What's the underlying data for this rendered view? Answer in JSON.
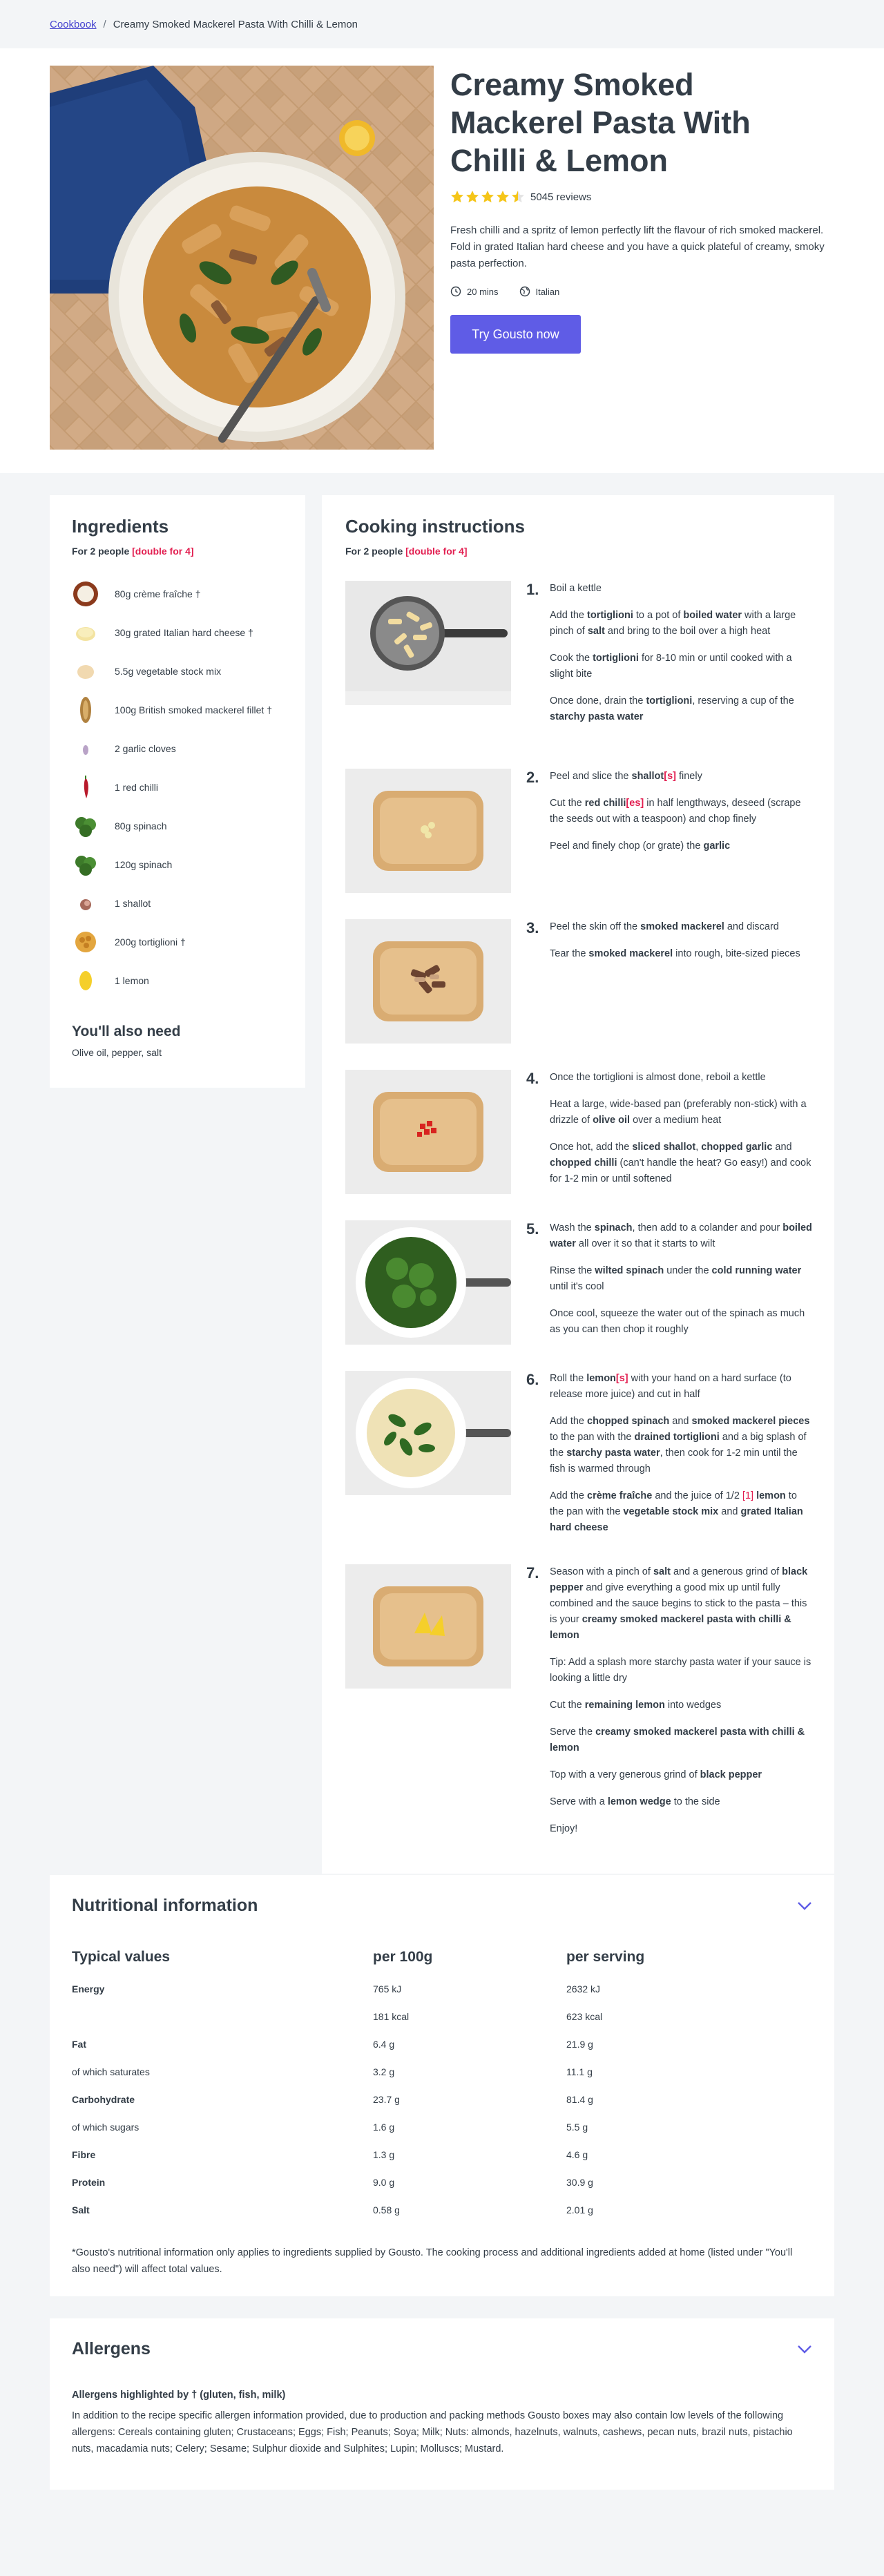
{
  "breadcrumb": {
    "root": "Cookbook",
    "separator": "/",
    "current": "Creamy Smoked Mackerel Pasta With Chilli & Lemon"
  },
  "hero": {
    "title": "Creamy Smoked Mackerel Pasta With Chilli & Lemon",
    "rating_stars": 4.5,
    "reviews": "5045 reviews",
    "description": "Fresh chilli and a spritz of lemon perfectly lift the flavour of rich smoked mackerel. Fold in grated Italian hard cheese and you have a quick plateful of creamy, smoky pasta perfection.",
    "time": "20 mins",
    "cuisine": "Italian",
    "cta": "Try Gousto now",
    "colors": {
      "accent": "#5f5ce6",
      "star": "#f5c518",
      "highlight": "#e21e50"
    }
  },
  "ingredients": {
    "heading": "Ingredients",
    "servings_prefix": "For 2 people",
    "servings_double": "[double for 4]",
    "items": [
      {
        "text": "80g crème fraîche †",
        "icon": "creme-fraiche-icon"
      },
      {
        "text": "30g grated Italian hard cheese †",
        "icon": "cheese-icon"
      },
      {
        "text": "5.5g vegetable stock mix",
        "icon": "stock-icon"
      },
      {
        "text": "100g British smoked mackerel fillet †",
        "icon": "mackerel-icon"
      },
      {
        "text": "2 garlic cloves",
        "icon": "garlic-icon"
      },
      {
        "text": "1 red chilli",
        "icon": "chilli-icon"
      },
      {
        "text": "80g spinach",
        "icon": "spinach-icon"
      },
      {
        "text": "120g spinach",
        "icon": "spinach-icon"
      },
      {
        "text": "1 shallot",
        "icon": "shallot-icon"
      },
      {
        "text": "200g tortiglioni †",
        "icon": "pasta-icon"
      },
      {
        "text": "1 lemon",
        "icon": "lemon-icon"
      }
    ],
    "also_need_heading": "You'll also need",
    "also_need_text": "Olive oil, pepper, salt"
  },
  "cooking": {
    "heading": "Cooking instructions",
    "servings_prefix": "For 2 people",
    "servings_double": "[double for 4]",
    "steps": [
      {
        "num": "1.",
        "paras": [
          "Boil a kettle",
          "Add the <b>tortiglioni</b> to a pot of <b>boiled water</b> with a large pinch of <b>salt</b> and bring to the boil over a high heat",
          "Cook the <b>tortiglioni</b> for 8-10 min or until cooked with a slight bite",
          "Once done, drain the <b>tortiglioni</b>, reserving a cup of the <b>starchy pasta water</b>"
        ]
      },
      {
        "num": "2.",
        "paras": [
          "Peel and slice the <b>shallot<span class='red'>[s]</span></b> finely",
          "Cut the <b>red chilli<span class='red'>[es]</span></b> in half lengthways, deseed (scrape the seeds out with a teaspoon) and chop finely",
          "Peel and finely chop (or grate) the <b>garlic</b>"
        ]
      },
      {
        "num": "3.",
        "paras": [
          "Peel the skin off the <b>smoked mackerel</b> and discard",
          "Tear the <b>smoked mackerel</b> into rough, bite-sized pieces"
        ]
      },
      {
        "num": "4.",
        "paras": [
          "Once the tortiglioni is almost done, reboil a kettle",
          "Heat a large, wide-based pan (preferably non-stick) with a drizzle of <b>olive oil</b> over a medium heat",
          "Once hot, add the <b>sliced shallot</b>, <b>chopped garlic</b> and <b>chopped chilli</b> (can't handle the heat? Go easy!) and cook for 1-2 min or until softened"
        ]
      },
      {
        "num": "5.",
        "paras": [
          "Wash the <b>spinach</b>, then add to a colander and pour <b>boiled water</b> all over it so that it starts to wilt",
          "Rinse the <b>wilted spinach</b> under the <b>cold running water</b> until it's cool",
          "Once cool, squeeze the water out of the spinach as much as you can then chop it roughly"
        ]
      },
      {
        "num": "6.",
        "paras": [
          "Roll the <b>lemon<span class='red'>[s]</span></b> with your hand on a hard surface (to release more juice) and cut in half",
          "Add the <b>chopped spinach</b> and <b>smoked mackerel pieces</b> to the pan with the <b>drained tortiglioni</b> and a big splash of the <b>starchy pasta water</b>, then cook for 1-2 min until the fish is warmed through",
          "Add the <b>crème fraîche</b> and the juice of 1/2 <span class='red'>[1]</span> <b>lemon</b> to the pan with the <b>vegetable stock mix</b> and <b>grated Italian hard cheese</b>"
        ]
      },
      {
        "num": "7.",
        "paras": [
          "Season with a pinch of <b>salt</b> and a generous grind of <b>black pepper</b> and give everything a good mix up until fully combined and the sauce begins to stick to the pasta – this is your <b>creamy smoked mackerel pasta with chilli & lemon</b>",
          "Tip: Add a splash more starchy pasta water if your sauce is looking a little dry",
          "Cut the <b>remaining lemon</b> into wedges",
          "Serve the <b>creamy smoked mackerel pasta with chilli & lemon</b>",
          "Top with a very generous grind of <b>black pepper</b>",
          "Serve with a <b>lemon wedge</b> to the side",
          "Enjoy!"
        ]
      }
    ]
  },
  "nutrition": {
    "heading": "Nutritional information",
    "columns": [
      "Typical values",
      "per 100g",
      "per serving"
    ],
    "rows": [
      {
        "label": "Energy",
        "per100": "765 kJ",
        "serving": "2632 kJ",
        "sub": false
      },
      {
        "label": "",
        "per100": "181 kcal",
        "serving": "623 kcal",
        "sub": true
      },
      {
        "label": "Fat",
        "per100": "6.4 g",
        "serving": "21.9 g",
        "sub": false
      },
      {
        "label": "of which saturates",
        "per100": "3.2 g",
        "serving": "11.1 g",
        "sub": true
      },
      {
        "label": "Carbohydrate",
        "per100": "23.7 g",
        "serving": "81.4 g",
        "sub": false
      },
      {
        "label": "of which sugars",
        "per100": "1.6 g",
        "serving": "5.5 g",
        "sub": true
      },
      {
        "label": "Fibre",
        "per100": "1.3 g",
        "serving": "4.6 g",
        "sub": false
      },
      {
        "label": "Protein",
        "per100": "9.0 g",
        "serving": "30.9 g",
        "sub": false
      },
      {
        "label": "Salt",
        "per100": "0.58 g",
        "serving": "2.01 g",
        "sub": false
      }
    ],
    "note": "*Gousto's nutritional information only applies to ingredients supplied by Gousto. The cooking process and additional ingredients added at home (listed under \"You'll also need\") will affect total values."
  },
  "allergens": {
    "heading": "Allergens",
    "highlighted": "Allergens highlighted by † (gluten, fish, milk)",
    "text": "In addition to the recipe specific allergen information provided, due to production and packing methods Gousto boxes may also contain low levels of the following allergens: Cereals containing gluten; Crustaceans; Eggs; Fish; Peanuts; Soya; Milk; Nuts: almonds, hazelnuts, walnuts, cashews, pecan nuts, brazil nuts, pistachio nuts, macadamia nuts; Celery; Sesame; Sulphur dioxide and Sulphites; Lupin; Molluscs; Mustard."
  }
}
